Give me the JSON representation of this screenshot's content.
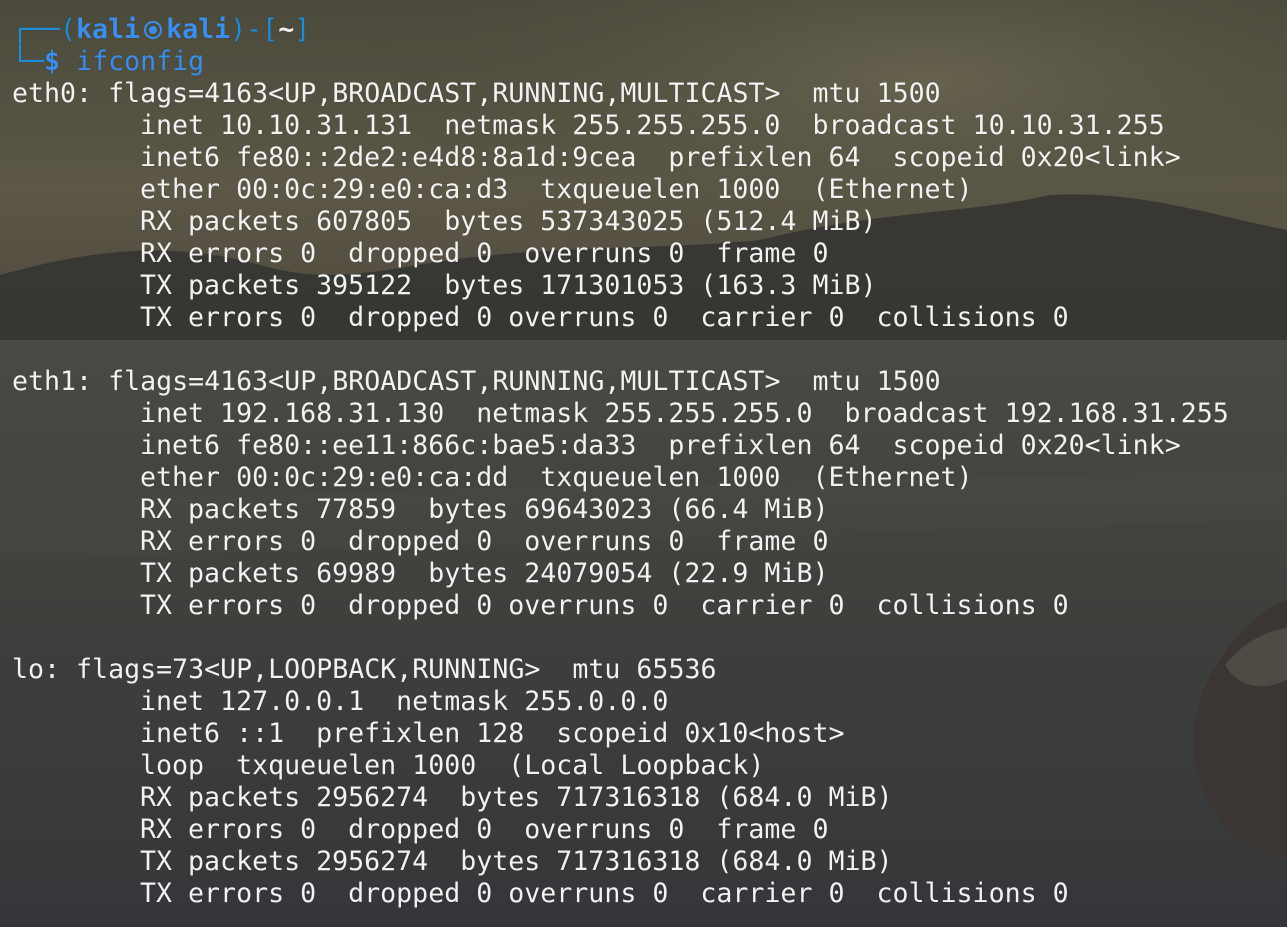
{
  "prompt": {
    "frame_top": "┌──(",
    "user": "kali",
    "skull_icon": "kali-skull-icon",
    "host": "kali",
    "frame_mid": ")-[",
    "cwd": "~",
    "frame_end": "]",
    "frame_bottom": "└─",
    "dollar": "$",
    "command": "ifconfig"
  },
  "interfaces": [
    {
      "header": "eth0: flags=4163<UP,BROADCAST,RUNNING,MULTICAST>  mtu 1500",
      "lines": [
        "inet 10.10.31.131  netmask 255.255.255.0  broadcast 10.10.31.255",
        "inet6 fe80::2de2:e4d8:8a1d:9cea  prefixlen 64  scopeid 0x20<link>",
        "ether 00:0c:29:e0:ca:d3  txqueuelen 1000  (Ethernet)",
        "RX packets 607805  bytes 537343025 (512.4 MiB)",
        "RX errors 0  dropped 0  overruns 0  frame 0",
        "TX packets 395122  bytes 171301053 (163.3 MiB)",
        "TX errors 0  dropped 0 overruns 0  carrier 0  collisions 0"
      ]
    },
    {
      "header": "eth1: flags=4163<UP,BROADCAST,RUNNING,MULTICAST>  mtu 1500",
      "lines": [
        "inet 192.168.31.130  netmask 255.255.255.0  broadcast 192.168.31.255",
        "inet6 fe80::ee11:866c:bae5:da33  prefixlen 64  scopeid 0x20<link>",
        "ether 00:0c:29:e0:ca:dd  txqueuelen 1000  (Ethernet)",
        "RX packets 77859  bytes 69643023 (66.4 MiB)",
        "RX errors 0  dropped 0  overruns 0  frame 0",
        "TX packets 69989  bytes 24079054 (22.9 MiB)",
        "TX errors 0  dropped 0 overruns 0  carrier 0  collisions 0"
      ]
    },
    {
      "header": "lo: flags=73<UP,LOOPBACK,RUNNING>  mtu 65536",
      "lines": [
        "inet 127.0.0.1  netmask 255.0.0.0",
        "inet6 ::1  prefixlen 128  scopeid 0x10<host>",
        "loop  txqueuelen 1000  (Local Loopback)",
        "RX packets 2956274  bytes 717316318 (684.0 MiB)",
        "RX errors 0  dropped 0  overruns 0  frame 0",
        "TX packets 2956274  bytes 717316318 (684.0 MiB)",
        "TX errors 0  dropped 0 overruns 0  carrier 0  collisions 0"
      ]
    }
  ]
}
